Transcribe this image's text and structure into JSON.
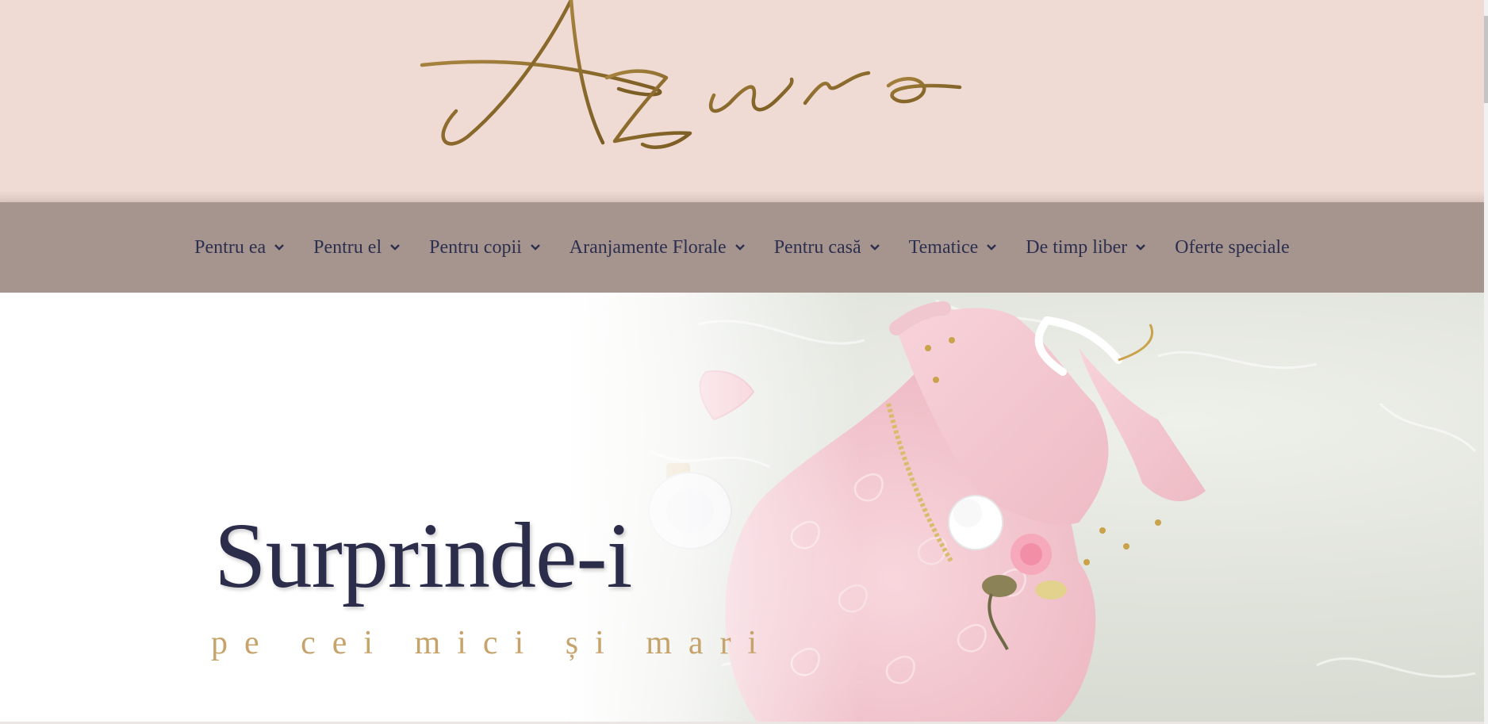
{
  "brand": {
    "logo_text": "Azuro"
  },
  "nav": {
    "items": [
      {
        "label": "Pentru ea",
        "has_dropdown": true
      },
      {
        "label": "Pentru el",
        "has_dropdown": true
      },
      {
        "label": "Pentru copii",
        "has_dropdown": true
      },
      {
        "label": "Aranjamente Florale",
        "has_dropdown": true
      },
      {
        "label": "Pentru casă",
        "has_dropdown": true
      },
      {
        "label": "Tematice",
        "has_dropdown": true
      },
      {
        "label": "De timp liber",
        "has_dropdown": true
      },
      {
        "label": "Oferte speciale",
        "has_dropdown": false
      }
    ]
  },
  "hero": {
    "title": "Surprinde-i",
    "subtitle": "pe cei mici și mari",
    "image": "pink-dress-on-fur-icon"
  },
  "colors": {
    "header_bg": "#efdbd3",
    "nav_bg": "#a6958f",
    "nav_text": "#2d2f4e",
    "logo_gold": "#8a6a2c",
    "title": "#2b2d4b",
    "subtitle_gold": "#c6a36a"
  }
}
